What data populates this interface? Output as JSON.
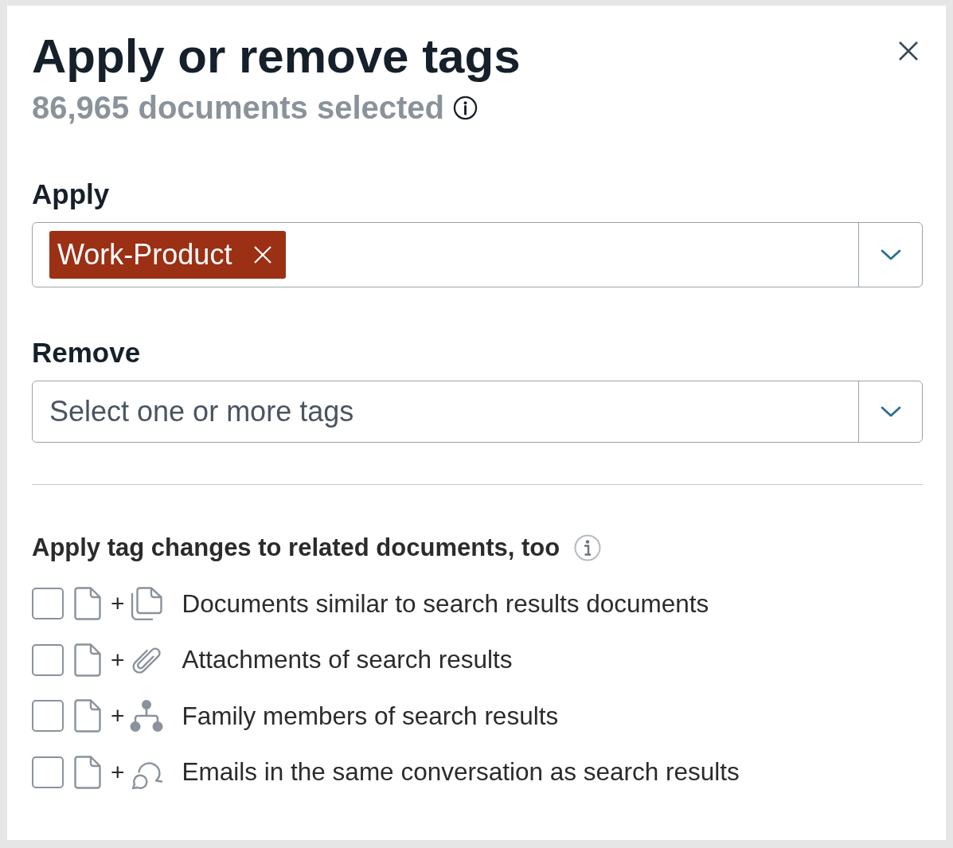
{
  "dialog": {
    "title": "Apply or remove tags",
    "subtitle": "86,965 documents selected"
  },
  "fields": [
    {
      "label": "Apply",
      "tags": [
        {
          "text": "Work-Product",
          "color": "#9b3015"
        }
      ]
    },
    {
      "label": "Remove",
      "placeholder": "Select one or more tags"
    }
  ],
  "related": {
    "heading": "Apply tag changes to related documents, too",
    "options": [
      {
        "kind": "similar",
        "joiner": "+",
        "label": "Documents similar to search results documents",
        "checked": false
      },
      {
        "kind": "attachments",
        "joiner": "+",
        "label": "Attachments of search results",
        "checked": false
      },
      {
        "kind": "family",
        "joiner": "+",
        "label": "Family members of search results",
        "checked": false
      },
      {
        "kind": "conversation",
        "joiner": "+",
        "label": "Emails in the same conversation as search results",
        "checked": false
      }
    ]
  }
}
